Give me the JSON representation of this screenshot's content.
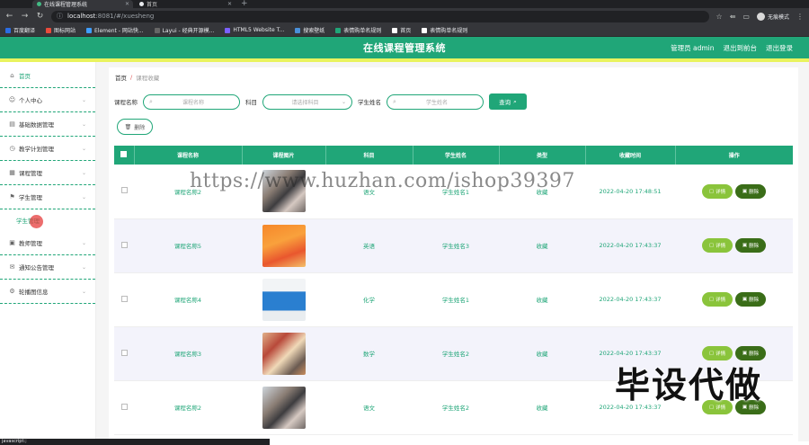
{
  "browser": {
    "tabs": [
      {
        "title": "在线课程管理系统",
        "active": true
      },
      {
        "title": "首页",
        "active": false
      }
    ],
    "url_host": "localhost",
    "url_rest": ":8081/#/xuesheng",
    "profile_label": "无痕模式",
    "bookmarks": [
      {
        "label": "百度翻译",
        "icon": "translate-icon",
        "color": "#2b6de3"
      },
      {
        "label": "图标网站",
        "icon": "icons-site-icon",
        "color": "#e94b3c"
      },
      {
        "label": "Element - 网站快...",
        "icon": "element-icon",
        "color": "#409eff"
      },
      {
        "label": "Layui - 经典开源模...",
        "icon": "layui-icon",
        "color": "#666666"
      },
      {
        "label": "HTML5 Website T...",
        "icon": "html5-icon",
        "color": "#7b61ff"
      },
      {
        "label": "搜索壁纸",
        "icon": "wallpaper-icon",
        "color": "#4a90d9"
      },
      {
        "label": "表情购单名规则",
        "icon": "rules-icon",
        "color": "#20a678"
      },
      {
        "label": "首页",
        "icon": "home-site-icon",
        "color": "#ffffff"
      },
      {
        "label": "表情购单名规则",
        "icon": "rules-icon",
        "color": "#ffffff"
      }
    ],
    "status_url": "javascript:;"
  },
  "header": {
    "title": "在线课程管理系统",
    "links": [
      "管理员 admin",
      "退出到前台",
      "退出登录"
    ]
  },
  "sidebar": {
    "items": [
      {
        "label": "首页",
        "icon": "home-icon",
        "has_chevron": false
      },
      {
        "label": "个人中心",
        "icon": "user-icon",
        "has_chevron": true
      },
      {
        "label": "基础数据管理",
        "icon": "database-icon",
        "has_chevron": true
      },
      {
        "label": "教学计划管理",
        "icon": "plan-icon",
        "has_chevron": true
      },
      {
        "label": "课程管理",
        "icon": "course-icon",
        "has_chevron": true
      },
      {
        "label": "学生管理",
        "icon": "flag-icon",
        "has_chevron": true
      },
      {
        "label": "教师管理",
        "icon": "teacher-icon",
        "has_chevron": true
      },
      {
        "label": "通知公告管理",
        "icon": "notice-icon",
        "has_chevron": true
      },
      {
        "label": "轮播图信息",
        "icon": "carousel-icon",
        "has_chevron": true
      }
    ],
    "sub_item": "学生管理"
  },
  "breadcrumb": {
    "home": "首页",
    "separator": "/",
    "current": "课程收藏"
  },
  "search": {
    "course_name_label": "课程名称",
    "course_name_placeholder": "课程名称",
    "subject_label": "科目",
    "subject_placeholder": "请选择科目",
    "student_name_label": "学生姓名",
    "student_name_placeholder": "学生姓名",
    "query_button": "查询"
  },
  "toolbar": {
    "delete_button": "删除"
  },
  "table": {
    "columns": [
      "课程名称",
      "课程图片",
      "科目",
      "学生姓名",
      "类型",
      "收藏时间",
      "操作"
    ],
    "detail_label": "详情",
    "delete_label": "删除",
    "rows": [
      {
        "course": "课程名称2",
        "subject": "语文",
        "student": "学生姓名1",
        "type": "收藏",
        "time": "2022-04-20 17:48:51",
        "thumb": "classroom-photo"
      },
      {
        "course": "课程名称5",
        "subject": "英语",
        "student": "学生姓名3",
        "type": "收藏",
        "time": "2022-04-20 17:43:37",
        "thumb": "poster-orange"
      },
      {
        "course": "课程名称4",
        "subject": "化学",
        "student": "学生姓名1",
        "type": "收藏",
        "time": "2022-04-20 17:43:37",
        "thumb": "book-blue"
      },
      {
        "course": "课程名称3",
        "subject": "数学",
        "student": "学生姓名2",
        "type": "收藏",
        "time": "2022-04-20 17:43:37",
        "thumb": "classroom-photo-warm"
      },
      {
        "course": "课程名称2",
        "subject": "语文",
        "student": "学生姓名2",
        "type": "收藏",
        "time": "2022-04-20 17:43:37",
        "thumb": "classroom-photo"
      }
    ]
  },
  "overlays": {
    "watermark": "https://www.huzhan.com/ishop39397",
    "stamp": "毕设代做"
  },
  "colors": {
    "accent": "#20a678",
    "header_border": "#e9f35e",
    "detail_btn": "#8ac43b",
    "delete_btn": "#3a6d18"
  }
}
